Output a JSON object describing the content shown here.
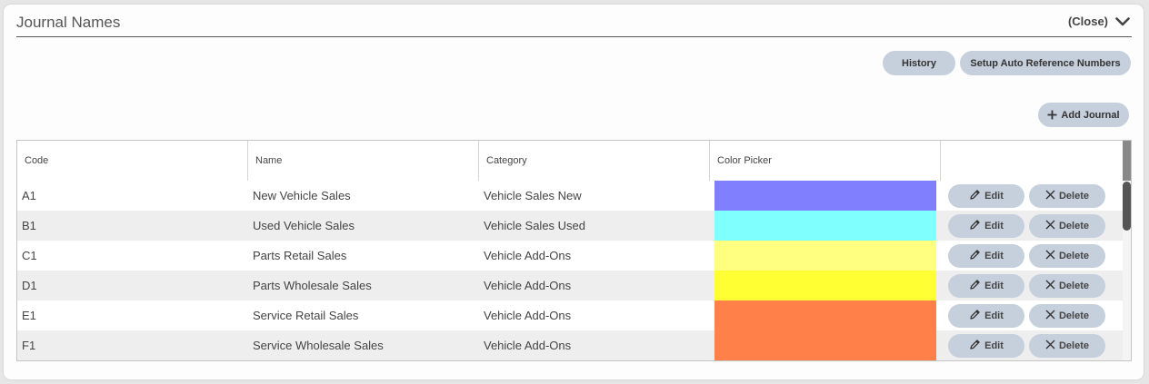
{
  "header": {
    "title": "Journal Names",
    "close_label": "(Close)"
  },
  "toolbar": {
    "history_label": "History",
    "setup_label": "Setup Auto Reference Numbers",
    "add_journal_label": "Add Journal"
  },
  "table": {
    "columns": [
      "Code",
      "Name",
      "Category",
      "Color Picker",
      ""
    ],
    "rows": [
      {
        "code": "A1",
        "name": "New Vehicle Sales",
        "category": "Vehicle Sales New",
        "color": "#8080ff"
      },
      {
        "code": "B1",
        "name": "Used Vehicle Sales",
        "category": "Vehicle Sales Used",
        "color": "#80ffff"
      },
      {
        "code": "C1",
        "name": "Parts Retail Sales",
        "category": "Vehicle Add-Ons",
        "color": "#ffff80"
      },
      {
        "code": "D1",
        "name": "Parts Wholesale Sales",
        "category": "Vehicle Add-Ons",
        "color": "#ffff33"
      },
      {
        "code": "E1",
        "name": "Service Retail Sales",
        "category": "Vehicle Add-Ons",
        "color": "#ff8049"
      },
      {
        "code": "F1",
        "name": "Service Wholesale Sales",
        "category": "Vehicle Add-Ons",
        "color": "#ff8049"
      }
    ],
    "edit_label": "Edit",
    "delete_label": "Delete"
  },
  "icons": {
    "close": "chevron-down-icon",
    "add": "plus-icon",
    "edit": "pencil-icon",
    "delete": "x-icon"
  }
}
